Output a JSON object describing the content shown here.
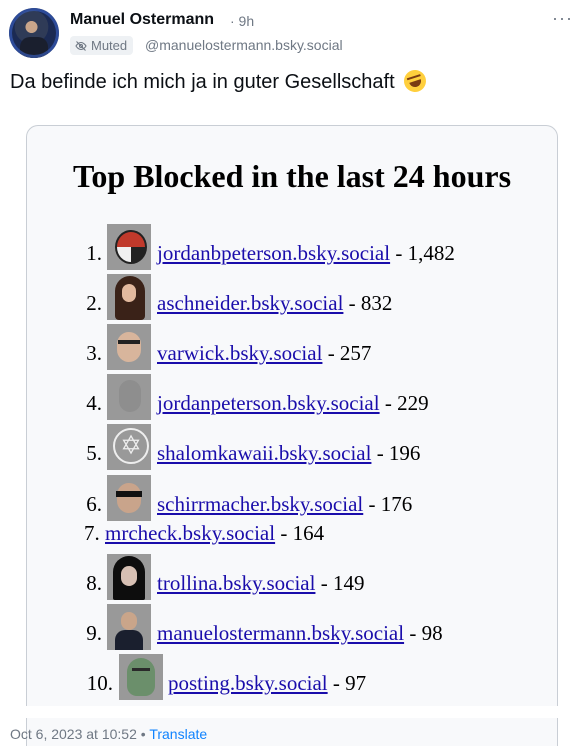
{
  "post": {
    "author_name": "Manuel Ostermann",
    "time_ago": "· 9h",
    "muted_label": "Muted",
    "handle": "@manuelostermann.bsky.social",
    "text": "Da befinde ich mich ja in guter Gesellschaft",
    "menu_label": "···",
    "timestamp": "Oct 6, 2023 at 10:52",
    "separator": "•",
    "translate_label": "Translate"
  },
  "image": {
    "title": "Top Blocked in the last 24 hours",
    "entries": [
      {
        "rank": "1.",
        "handle": "jordanbpeterson.bsky.social",
        "count": "- 1,482"
      },
      {
        "rank": "2.",
        "handle": "aschneider.bsky.social",
        "count": "- 832"
      },
      {
        "rank": "3.",
        "handle": "varwick.bsky.social",
        "count": "- 257"
      },
      {
        "rank": "4.",
        "handle": "jordanpeterson.bsky.social",
        "count": "- 229"
      },
      {
        "rank": "5.",
        "handle": "shalomkawaii.bsky.social",
        "count": "- 196"
      },
      {
        "rank": "6.",
        "handle": "schirrmacher.bsky.social",
        "count": "- 176"
      },
      {
        "rank": "7.",
        "handle": "mrcheck.bsky.social",
        "count": "- 164"
      },
      {
        "rank": "8.",
        "handle": "trollina.bsky.social",
        "count": "- 149"
      },
      {
        "rank": "9.",
        "handle": "manuelostermann.bsky.social",
        "count": "- 98"
      },
      {
        "rank": "10.",
        "handle": "posting.bsky.social",
        "count": "- 97"
      }
    ]
  },
  "icons": {
    "avatar": "avatar-icon",
    "muted": "eye-off-icon",
    "emoji": "rolling-on-floor-laughing-emoji-icon",
    "menu": "more-horizontal-icon"
  }
}
